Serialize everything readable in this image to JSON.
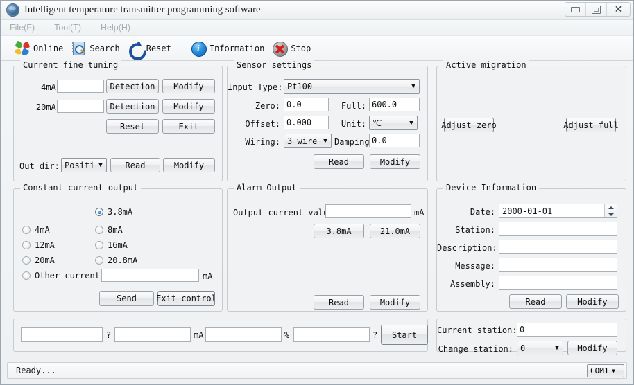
{
  "window": {
    "title": "Intelligent temperature transmitter programming software",
    "icon": "app-globe-icon",
    "controls": {
      "minimize": "_",
      "maximize": "□",
      "close": "✕"
    }
  },
  "menubar": {
    "items": [
      {
        "label": "File(F)"
      },
      {
        "label": "Tool(T)"
      },
      {
        "label": "Help(H)"
      }
    ]
  },
  "toolbar": {
    "items": [
      {
        "label": "Online",
        "icon": "online-icon"
      },
      {
        "label": "Search",
        "icon": "search-icon"
      },
      {
        "label": "Reset",
        "icon": "reset-icon"
      },
      {
        "label": "Information",
        "icon": "information-icon"
      },
      {
        "label": "Stop",
        "icon": "stop-icon"
      }
    ]
  },
  "current_fine_tuning": {
    "legend": "Current fine tuning",
    "row_4ma_label": "4mA:",
    "row_4ma_value": "",
    "row_4ma_detect": "Detection",
    "row_4ma_modify": "Modify",
    "row_20ma_label": "20mA:",
    "row_20ma_value": "",
    "row_20ma_detect": "Detection",
    "row_20ma_modify": "Modify",
    "reset_button": "Reset",
    "exit_button": "Exit",
    "out_dir_label": "Out dir:",
    "out_dir_value": "Positive",
    "out_dir_read": "Read",
    "out_dir_modify": "Modify"
  },
  "sensor_settings": {
    "legend": "Sensor settings",
    "input_type_label": "Input Type:",
    "input_type_value": "Pt100",
    "zero_label": "Zero:",
    "zero_value": "0.0",
    "full_label": "Full:",
    "full_value": "600.0",
    "offset_label": "Offset:",
    "offset_value": "0.000",
    "unit_label": "Unit:",
    "unit_value": "℃",
    "wiring_label": "Wiring:",
    "wiring_value": "3 wire",
    "damping_label": "Damping:",
    "damping_value": "0.0",
    "read_button": "Read",
    "modify_button": "Modify"
  },
  "active_migration": {
    "legend": "Active migration",
    "adjust_zero": "Adjust zero",
    "adjust_full": "Adjust full"
  },
  "constant_current_output": {
    "legend": "Constant current output",
    "options": [
      {
        "label": "3.8mA",
        "selected": true
      },
      {
        "label": "4mA",
        "selected": false
      },
      {
        "label": "8mA",
        "selected": false
      },
      {
        "label": "12mA",
        "selected": false
      },
      {
        "label": "16mA",
        "selected": false
      },
      {
        "label": "20mA",
        "selected": false
      },
      {
        "label": "20.8mA",
        "selected": false
      },
      {
        "label": "Other current:",
        "selected": false
      }
    ],
    "other_value": "",
    "other_unit": "mA",
    "send_button": "Send",
    "exit_control_button": "Exit control"
  },
  "alarm_output": {
    "legend": "Alarm Output",
    "output_current_label": "Output current value:",
    "output_current_value": "",
    "output_current_unit": "mA",
    "preset_low": "3.8mA",
    "preset_high": "21.0mA",
    "read_button": "Read",
    "modify_button": "Modify"
  },
  "device_information": {
    "legend": "Device Information",
    "fields": [
      {
        "label": "Date:",
        "value": "2000-01-01"
      },
      {
        "label": "Station:",
        "value": ""
      },
      {
        "label": "Description:",
        "value": ""
      },
      {
        "label": "Message:",
        "value": ""
      },
      {
        "label": "Assembly:",
        "value": ""
      }
    ],
    "read_button": "Read",
    "modify_button": "Modify"
  },
  "measure_bar": {
    "field1_value": "",
    "unit1": "?",
    "field2_value": "",
    "unit2": "mA",
    "field3_value": "",
    "unit3": "%",
    "field4_value": "",
    "unit4": "?",
    "start_button": "Start"
  },
  "station_bar": {
    "current_station_label": "Current station:",
    "current_station_value": "0",
    "change_station_label": "Change station:",
    "change_station_value": "0",
    "modify_button": "Modify"
  },
  "statusbar": {
    "text": "Ready...",
    "port": "COM1"
  }
}
